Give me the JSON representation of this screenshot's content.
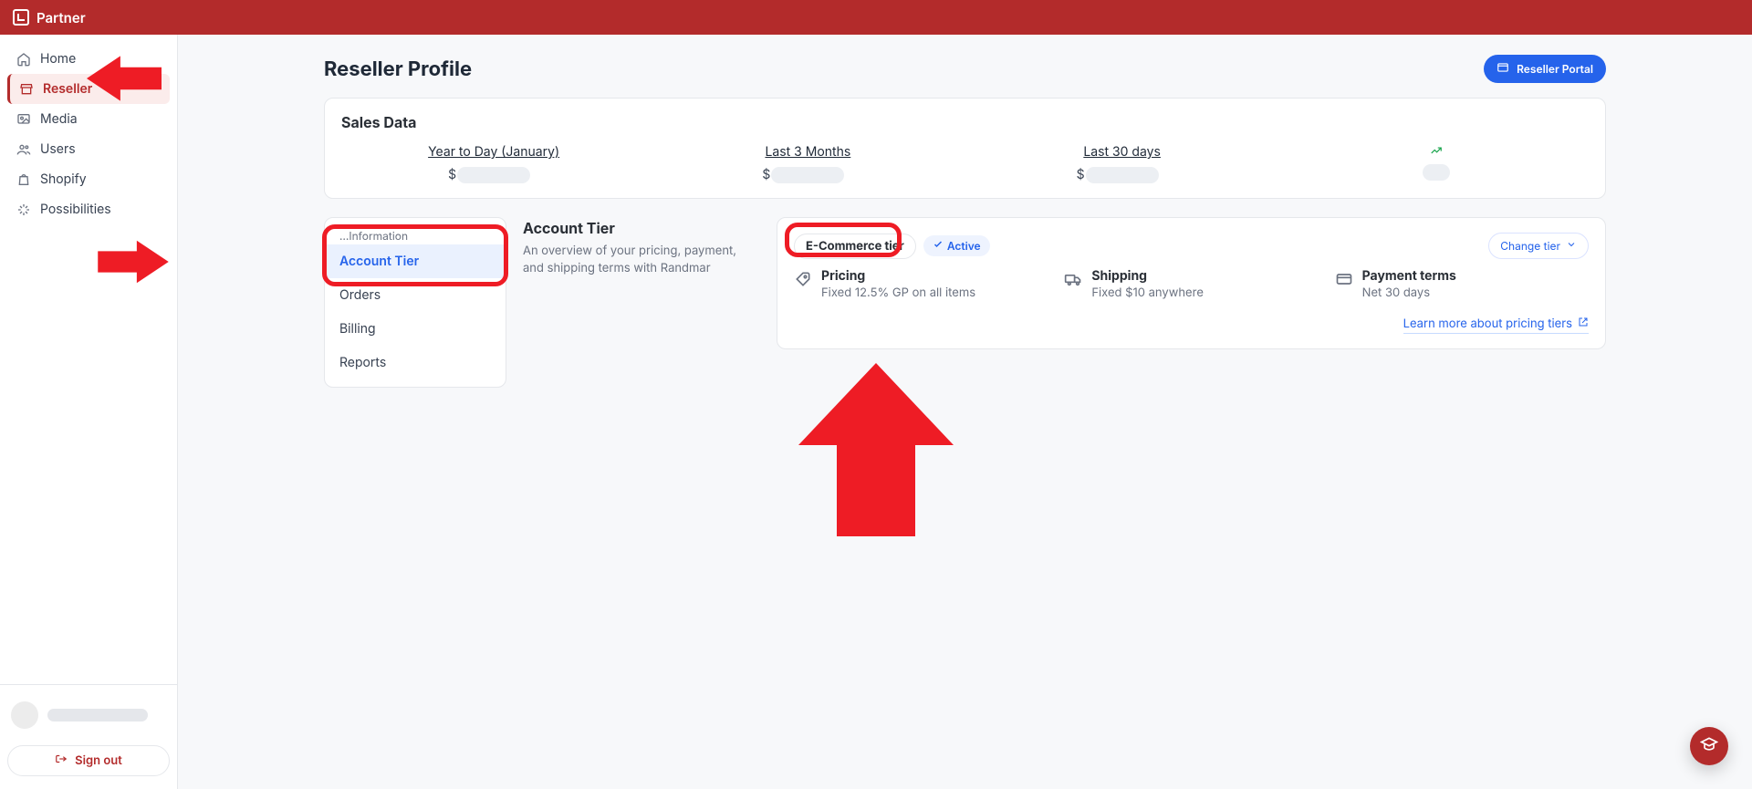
{
  "header": {
    "brand": "Partner"
  },
  "sidebar": {
    "items": [
      {
        "label": "Home"
      },
      {
        "label": "Reseller"
      },
      {
        "label": "Media"
      },
      {
        "label": "Users"
      },
      {
        "label": "Shopify"
      },
      {
        "label": "Possibilities"
      }
    ],
    "signout": "Sign out"
  },
  "page": {
    "title": "Reseller Profile",
    "portal_button": "Reseller Portal"
  },
  "sales": {
    "title": "Sales Data",
    "stats": [
      {
        "label": "Year to Day (January)",
        "prefix": "$"
      },
      {
        "label": "Last 3 Months",
        "prefix": "$"
      },
      {
        "label": "Last 30 days",
        "prefix": "$"
      }
    ]
  },
  "subnav": {
    "top_trim": "…Information",
    "items": [
      {
        "label": "Account Tier",
        "active": true
      },
      {
        "label": "Orders"
      },
      {
        "label": "Billing"
      },
      {
        "label": "Reports"
      }
    ]
  },
  "tier_info": {
    "title": "Account Tier",
    "desc": "An overview of your pricing, payment, and shipping terms with Randmar"
  },
  "tier_card": {
    "chip": "E-Commerce tier",
    "active_pill": "Active",
    "change_tier": "Change tier",
    "blocks": [
      {
        "title": "Pricing",
        "sub": "Fixed 12.5% GP on all items"
      },
      {
        "title": "Shipping",
        "sub": "Fixed $10 anywhere"
      },
      {
        "title": "Payment terms",
        "sub": "Net 30 days"
      }
    ],
    "learn_more": "Learn more about pricing tiers"
  }
}
